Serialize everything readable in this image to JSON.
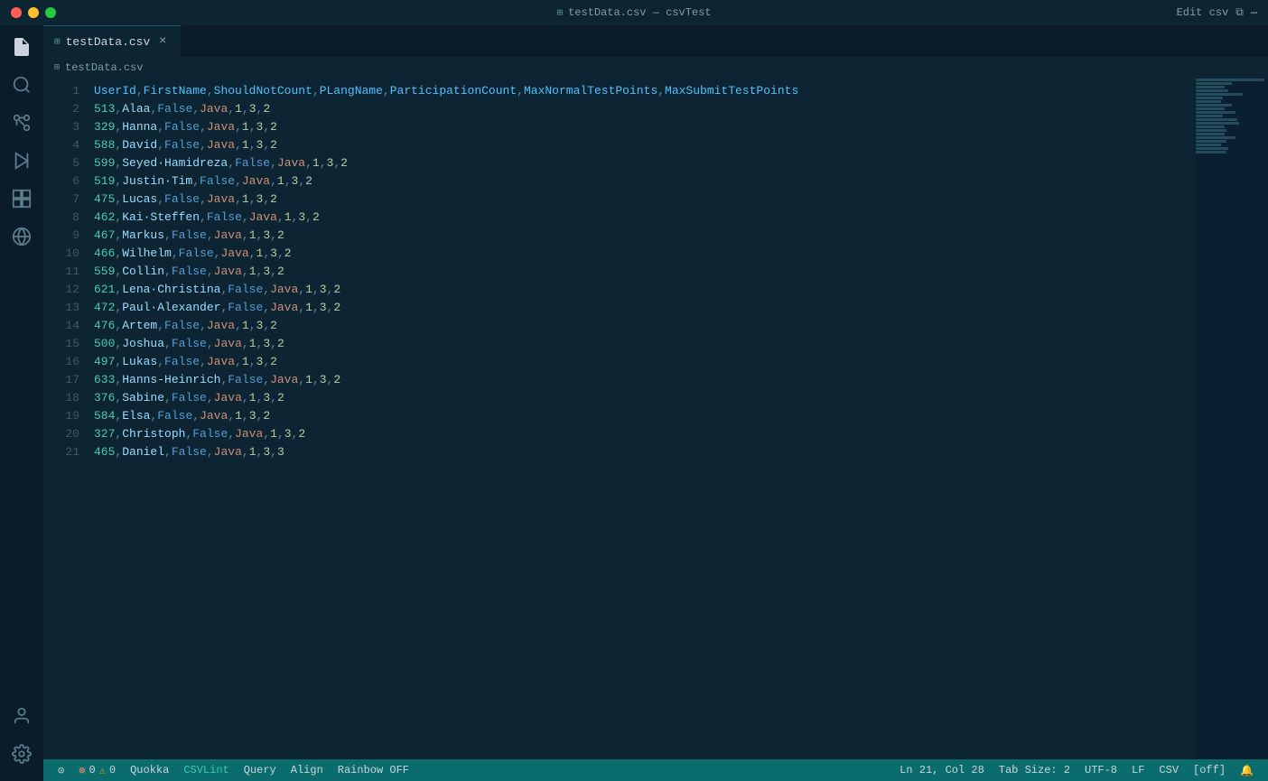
{
  "window": {
    "title": "testData.csv — csvTest"
  },
  "tab": {
    "icon": "⊞",
    "filename": "testData.csv",
    "close_label": "×"
  },
  "breadcrumb": {
    "icon": "⊞",
    "path": "testData.csv"
  },
  "activity_bar": {
    "icons": [
      {
        "name": "files-icon",
        "glyph": "⧉",
        "active": true
      },
      {
        "name": "search-icon",
        "glyph": "🔍"
      },
      {
        "name": "source-control-icon",
        "glyph": "⎇"
      },
      {
        "name": "run-icon",
        "glyph": "▷"
      },
      {
        "name": "extensions-icon",
        "glyph": "⊞"
      },
      {
        "name": "remote-explorer-icon",
        "glyph": "⊙"
      }
    ],
    "bottom": [
      {
        "name": "account-icon",
        "glyph": "◯"
      },
      {
        "name": "settings-icon",
        "glyph": "⚙"
      }
    ]
  },
  "header_row": "UserId,FirstName,ShouldNotCount,PLangName,ParticipationCount,MaxNormalTestPoints,MaxSubmitTestPoints",
  "rows": [
    {
      "num": 1,
      "id": "UserId",
      "rest": ",FirstName,ShouldNotCount,PLangName,ParticipationCount,MaxNormalTestPoints,MaxSubmitTestPoints",
      "is_header": true
    },
    {
      "num": 2,
      "id": "513",
      "name": "Alaa",
      "bool": "False",
      "lang": "Java",
      "n1": "1",
      "n2": "3",
      "n3": "2"
    },
    {
      "num": 3,
      "id": "329",
      "name": "Hanna",
      "bool": "False",
      "lang": "Java",
      "n1": "1",
      "n2": "3",
      "n3": "2"
    },
    {
      "num": 4,
      "id": "588",
      "name": "David",
      "bool": "False",
      "lang": "Java",
      "n1": "1",
      "n2": "3",
      "n3": "2"
    },
    {
      "num": 5,
      "id": "599",
      "name": "Seyed·Hamidreza",
      "bool": "False",
      "lang": "Java",
      "n1": "1",
      "n2": "3",
      "n3": "2"
    },
    {
      "num": 6,
      "id": "519",
      "name": "Justin·Tim",
      "bool": "False",
      "lang": "Java",
      "n1": "1",
      "n2": "3",
      "n3": "2"
    },
    {
      "num": 7,
      "id": "475",
      "name": "Lucas",
      "bool": "False",
      "lang": "Java",
      "n1": "1",
      "n2": "3",
      "n3": "2"
    },
    {
      "num": 8,
      "id": "462",
      "name": "Kai·Steffen",
      "bool": "False",
      "lang": "Java",
      "n1": "1",
      "n2": "3",
      "n3": "2"
    },
    {
      "num": 9,
      "id": "467",
      "name": "Markus",
      "bool": "False",
      "lang": "Java",
      "n1": "1",
      "n2": "3",
      "n3": "2"
    },
    {
      "num": 10,
      "id": "466",
      "name": "Wilhelm",
      "bool": "False",
      "lang": "Java",
      "n1": "1",
      "n2": "3",
      "n3": "2"
    },
    {
      "num": 11,
      "id": "559",
      "name": "Collin",
      "bool": "False",
      "lang": "Java",
      "n1": "1",
      "n2": "3",
      "n3": "2"
    },
    {
      "num": 12,
      "id": "621",
      "name": "Lena·Christina",
      "bool": "False",
      "lang": "Java",
      "n1": "1",
      "n2": "3",
      "n3": "2"
    },
    {
      "num": 13,
      "id": "472",
      "name": "Paul·Alexander",
      "bool": "False",
      "lang": "Java",
      "n1": "1",
      "n2": "3",
      "n3": "2"
    },
    {
      "num": 14,
      "id": "476",
      "name": "Artem",
      "bool": "False",
      "lang": "Java",
      "n1": "1",
      "n2": "3",
      "n3": "2"
    },
    {
      "num": 15,
      "id": "500",
      "name": "Joshua",
      "bool": "False",
      "lang": "Java",
      "n1": "1",
      "n2": "3",
      "n3": "2"
    },
    {
      "num": 16,
      "id": "497",
      "name": "Lukas",
      "bool": "False",
      "lang": "Java",
      "n1": "1",
      "n2": "3",
      "n3": "2"
    },
    {
      "num": 17,
      "id": "633",
      "name": "Hanns-Heinrich",
      "bool": "False",
      "lang": "Java",
      "n1": "1",
      "n2": "3",
      "n3": "2"
    },
    {
      "num": 18,
      "id": "376",
      "name": "Sabine",
      "bool": "False",
      "lang": "Java",
      "n1": "1",
      "n2": "3",
      "n3": "2"
    },
    {
      "num": 19,
      "id": "584",
      "name": "Elsa",
      "bool": "False",
      "lang": "Java",
      "n1": "1",
      "n2": "3",
      "n3": "2"
    },
    {
      "num": 20,
      "id": "327",
      "name": "Christoph",
      "bool": "False",
      "lang": "Java",
      "n1": "1",
      "n2": "3",
      "n3": "2"
    },
    {
      "num": 21,
      "id": "465",
      "name": "Daniel",
      "bool": "False",
      "lang": "Java",
      "n1": "1",
      "n2": "3",
      "n3": "3"
    }
  ],
  "status_bar": {
    "errors": "0",
    "warnings": "0",
    "language_server": "Quokka",
    "csvlint": "CSVLint",
    "query": "Query",
    "align": "Align",
    "rainbow": "Rainbow OFF",
    "cursor": "Ln 21, Col 28",
    "tab_size": "Tab Size: 2",
    "encoding": "UTF-8",
    "line_ending": "LF",
    "language": "CSV",
    "off_indicator": "[off]",
    "edit_csv": "Edit csv",
    "notifications_icon": "🔔",
    "remote_icon": "⊙"
  },
  "toolbar": {
    "edit_csv": "Edit csv"
  }
}
